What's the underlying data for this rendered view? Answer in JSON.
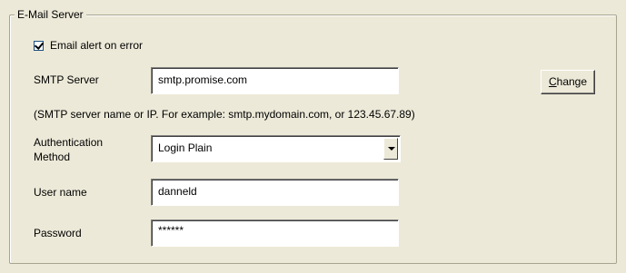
{
  "group": {
    "title": "E-Mail Server"
  },
  "email_alert": {
    "label": "Email alert on error",
    "checked": true
  },
  "smtp": {
    "label": "SMTP Server",
    "value": "smtp.promise.com",
    "change_button": "Change",
    "hint": "(SMTP server name or IP. For example: smtp.mydomain.com, or 123.45.67.89)"
  },
  "auth": {
    "label_line1": "Authentication",
    "label_line2": "Method",
    "selected": "Login Plain"
  },
  "username": {
    "label": "User name",
    "value": "danneld"
  },
  "password": {
    "label": "Password",
    "value": "******"
  }
}
